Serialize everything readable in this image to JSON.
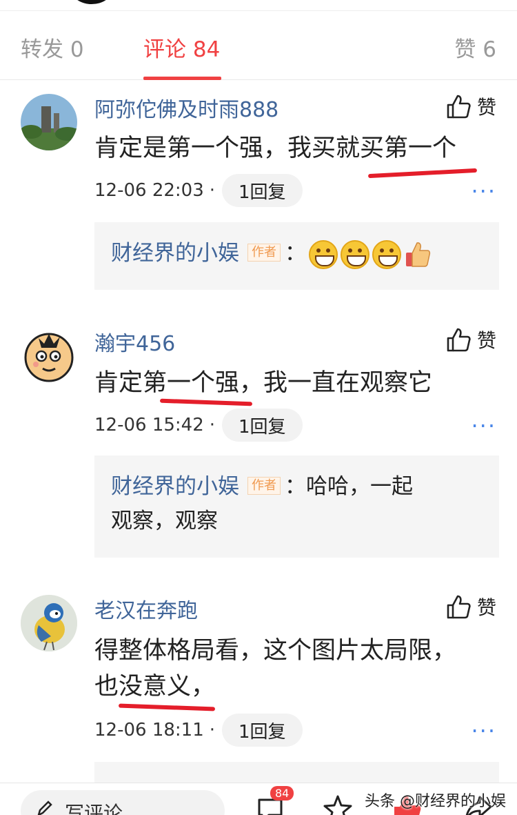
{
  "tabs": {
    "forward": "转发 0",
    "comments": "评论 84",
    "likes": "赞 6",
    "active_color": "#f04142"
  },
  "like_label": "赞",
  "more_label": "···",
  "author_badge": "作者",
  "comments": [
    {
      "username": "阿弥佗佛及时雨888",
      "text": "肯定是第一个强，我买就买第一个",
      "time": "12-06 22:03",
      "sep": "·",
      "reply_count": "1回复",
      "reply": {
        "author": "财经界的小娱",
        "colon": "：",
        "text": "",
        "emojis": [
          "grin-emoji",
          "grin-emoji",
          "grin-emoji",
          "thumbs-up-emoji"
        ]
      }
    },
    {
      "username": "瀚宇456",
      "text": "肯定第一个强，我一直在观察它",
      "time": "12-06 15:42",
      "sep": "·",
      "reply_count": "1回复",
      "reply": {
        "author": "财经界的小娱",
        "colon": "：",
        "text_line1": "哈哈，一起",
        "text_line2": "观察，观察"
      }
    },
    {
      "username": "老汉在奔跑",
      "text_line1": "得整体格局看，这个图片太局限，",
      "text_line2": "也没意义，",
      "time": "12-06 18:11",
      "sep": "·",
      "reply_count": "1回复"
    }
  ],
  "bottom_bar": {
    "write_label": "写评论",
    "comment_badge": "84",
    "watermark": "头条 @财经界的小娱"
  }
}
